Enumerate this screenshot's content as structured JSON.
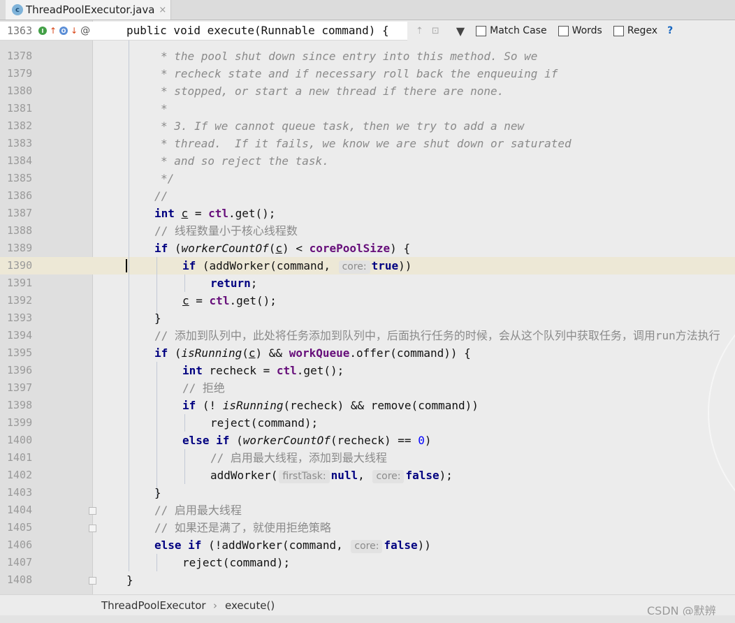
{
  "tab": {
    "icon": "class-icon",
    "icon_letter": "c",
    "filename": "ThreadPoolExecutor.java",
    "close": "×"
  },
  "sticky": {
    "line": "1363",
    "code": "public void execute(Runnable command) {"
  },
  "search": {
    "match_case": "Match Case",
    "words": "Words",
    "regex": "Regex",
    "help": "?"
  },
  "breadcrumb": {
    "class_name": "ThreadPoolExecutor",
    "separator": "›",
    "method": "execute()"
  },
  "watermark": "CSDN @默辨",
  "lines": [
    "1378",
    "1379",
    "1380",
    "1381",
    "1382",
    "1383",
    "1384",
    "1385",
    "1386",
    "1387",
    "1388",
    "1389",
    "1390",
    "1391",
    "1392",
    "1393",
    "1394",
    "1395",
    "1396",
    "1397",
    "1398",
    "1399",
    "1400",
    "1401",
    "1402",
    "1403",
    "1404",
    "1405",
    "1406",
    "1407",
    "1408"
  ],
  "code": {
    "l1378": "* the pool shut down since entry into this method. So we",
    "l1379": "* recheck state and if necessary roll back the enqueuing if",
    "l1380": "* stopped, or start a new thread if there are none.",
    "l1381": "*",
    "l1382": "* 3. If we cannot queue task, then we try to add a new",
    "l1383": "* thread.  If it fails, we know we are shut down or saturated",
    "l1384": "* and so reject the task.",
    "l1385": "*/",
    "l1386": "//",
    "int": "int",
    "c": "c",
    "ctl": "ctl",
    "get": ".get();",
    "l1388": "// 线程数量小于核心线程数",
    "if": "if",
    "workerCountOf": "workerCountOf",
    "corePoolSize": "corePoolSize",
    "addWorker": "addWorker",
    "command": "command",
    "hint_core": "core:",
    "hint_firstTask": "firstTask:",
    "true": "true",
    "false": "false",
    "null": "null",
    "return": "return",
    "l1394": "// 添加到队列中，此处将任务添加到队列中，后面执行任务的时候，会从这个队列中获取任务，调用run方法执行",
    "isRunning": "isRunning",
    "workQueue": "workQueue",
    "offer": ".offer(",
    "recheck": "recheck",
    "l1397": "// 拒绝",
    "remove": "remove",
    "reject": "reject",
    "else": "else",
    "zero": "0",
    "l1401": "// 启用最大线程，添加到最大线程",
    "l1404": "// 启用最大线程",
    "l1405": "// 如果还是满了，就使用拒绝策略"
  }
}
